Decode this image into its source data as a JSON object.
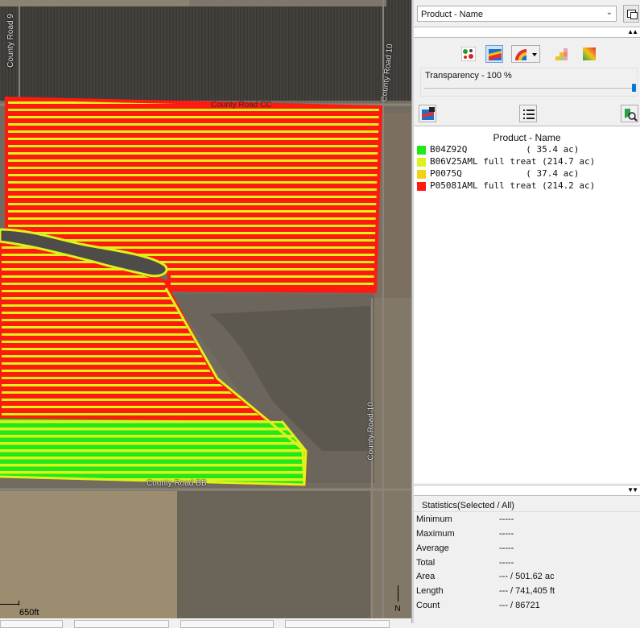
{
  "map": {
    "road_labels": {
      "county_road_9": "County Road 9",
      "county_road_10_upper": "County Road 10",
      "county_road_cc": "County Road CC",
      "county_road_10_lower": "County Road 10",
      "county_road_bb": "County Road BB"
    },
    "scale_text": "650ft",
    "north_label": "N",
    "product_colors": {
      "B04Z92Q": "#21e81b",
      "B06V25AML": "#ddf21a",
      "P0075Q": "#f6d112",
      "P05081AML": "#ff1a10"
    }
  },
  "panel": {
    "attribute_dropdown": {
      "selected": "Product - Name"
    },
    "transparency_label": "Transparency - 100 %",
    "transparency_percent": 100,
    "toolbar_icons": [
      "classify-points-icon",
      "map-layer-icon",
      "color-ramp-icon",
      "dropdown-arrow-icon",
      "grid-icon",
      "gradient-icon"
    ],
    "legend": {
      "title": "Product - Name",
      "items": [
        {
          "name": "B04Z92Q",
          "text": "B04Z92Q           ( 35.4 ac)",
          "color": "#21e81b"
        },
        {
          "name": "B06V25AML full treat",
          "text": "B06V25AML full treat (214.7 ac)",
          "color": "#ddf21a"
        },
        {
          "name": "P0075Q",
          "text": "P0075Q            ( 37.4 ac)",
          "color": "#f6d112"
        },
        {
          "name": "P05081AML full treat",
          "text": "P05081AML full treat (214.2 ac)",
          "color": "#ff1a10"
        }
      ]
    },
    "statistics": {
      "title": "Statistics(Selected / All)",
      "rows": [
        {
          "label": "Minimum",
          "value": "-----"
        },
        {
          "label": "Maximum",
          "value": "-----"
        },
        {
          "label": "Average",
          "value": "-----"
        },
        {
          "label": "Total",
          "value": "-----"
        },
        {
          "label": "Area",
          "value": "--- / 501.62 ac"
        },
        {
          "label": "Length",
          "value": "--- / 741,405 ft"
        },
        {
          "label": "Count",
          "value": "--- / 86721"
        }
      ]
    }
  }
}
